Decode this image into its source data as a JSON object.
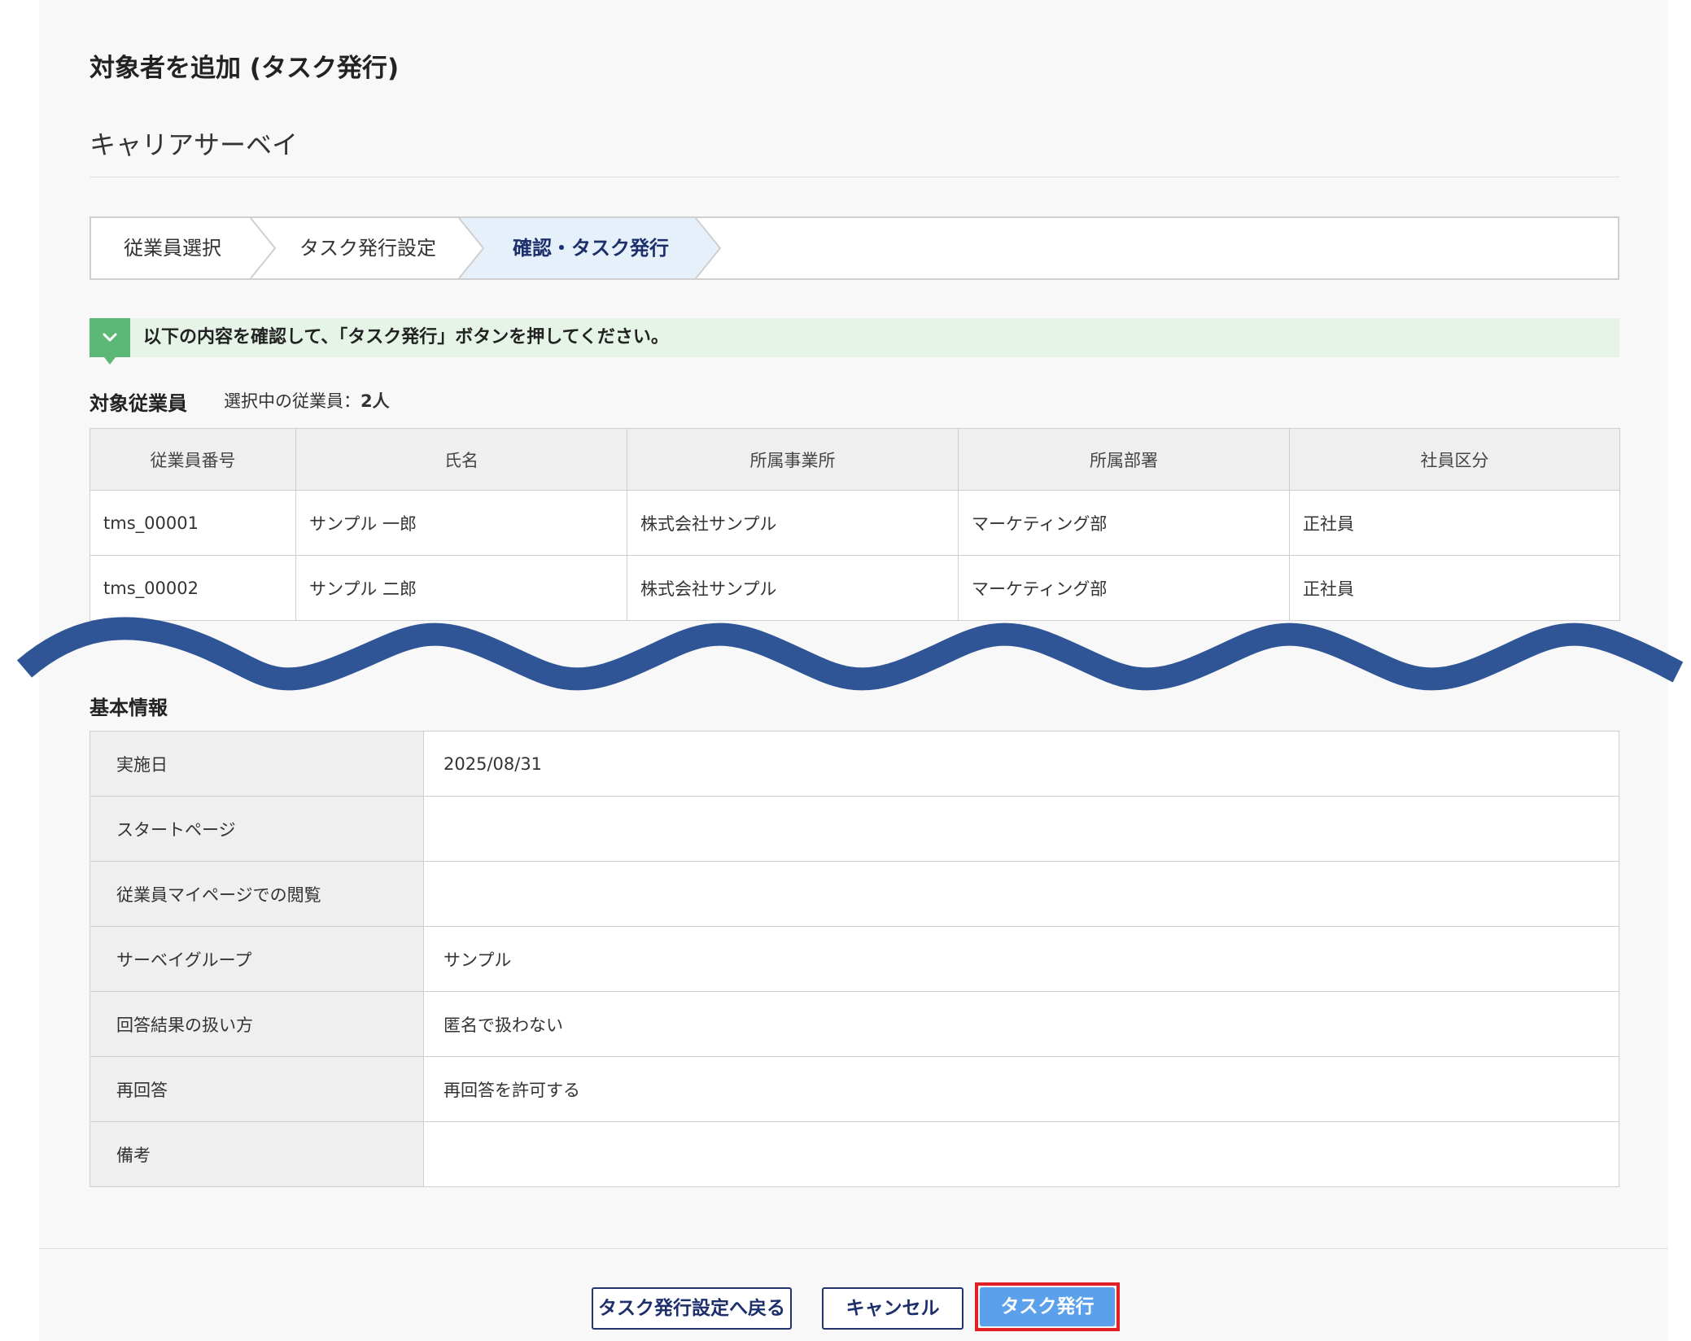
{
  "header": {
    "title": "対象者を追加 (タスク発行)",
    "subtitle": "キャリアサーベイ"
  },
  "stepper": {
    "steps": [
      {
        "label": "従業員選択",
        "active": false
      },
      {
        "label": "タスク発行設定",
        "active": false
      },
      {
        "label": "確認・タスク発行",
        "active": true
      }
    ]
  },
  "notice": {
    "icon": "chevron-down-icon",
    "text": "以下の内容を確認して、「タスク発行」ボタンを押してください。"
  },
  "employees": {
    "heading": "対象従業員",
    "selected_label": "選択中の従業員：",
    "selected_count": "2人",
    "columns": [
      "従業員番号",
      "氏名",
      "所属事業所",
      "所属部署",
      "社員区分"
    ],
    "rows": [
      [
        "tms_00001",
        "サンプル 一郎",
        "株式会社サンプル",
        "マーケティング部",
        "正社員"
      ],
      [
        "tms_00002",
        "サンプル 二郎",
        "株式会社サンプル",
        "マーケティング部",
        "正社員"
      ]
    ]
  },
  "basic_info": {
    "heading": "基本情報",
    "rows": [
      {
        "label": "実施日",
        "value": "2025/08/31"
      },
      {
        "label": "スタートページ",
        "value": ""
      },
      {
        "label": "従業員マイページでの閲覧",
        "value": ""
      },
      {
        "label": "サーベイグループ",
        "value": "サンプル"
      },
      {
        "label": "回答結果の扱い方",
        "value": "匿名で扱わない"
      },
      {
        "label": "再回答",
        "value": "再回答を許可する"
      },
      {
        "label": "備考",
        "value": ""
      }
    ]
  },
  "footer": {
    "back_label": "タスク発行設定へ戻る",
    "cancel_label": "キャンセル",
    "issue_label": "タスク発行"
  },
  "colors": {
    "accent_navy": "#1c2f6b",
    "primary_button": "#5ba0ea",
    "highlight_frame": "#e01f26",
    "notice_green": "#5cb877",
    "wave_blue": "#2f5597"
  }
}
